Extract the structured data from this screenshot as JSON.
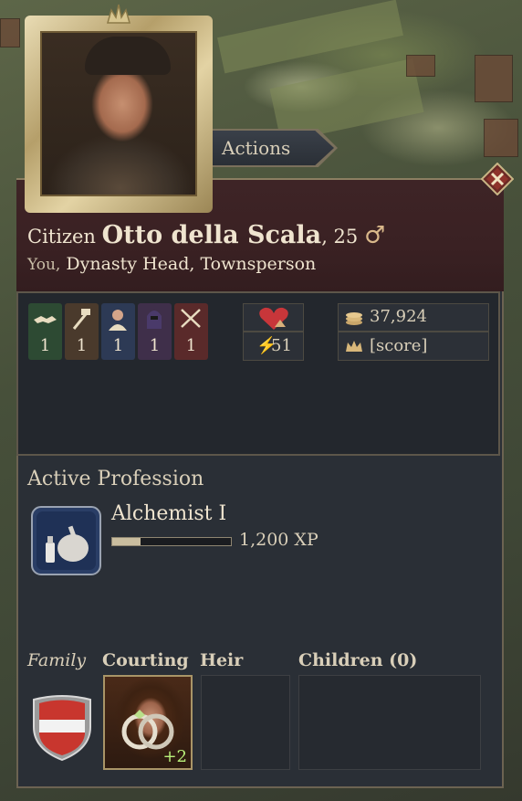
{
  "actions_tab": {
    "label": "Actions"
  },
  "character": {
    "title": "Citizen",
    "name": "Otto della Scala",
    "age_text": ", 25",
    "gender_symbol": "♂",
    "you_label": "You,",
    "role": "Dynasty Head",
    "class_text": ", Townsperson"
  },
  "skills": [
    {
      "icon": "handshake-icon",
      "value": "1",
      "color": "#2d4a33"
    },
    {
      "icon": "hammer-icon",
      "value": "1",
      "color": "#4a3a2c"
    },
    {
      "icon": "scholar-icon",
      "value": "1",
      "color": "#2d3a55"
    },
    {
      "icon": "hooded-figure-icon",
      "value": "1",
      "color": "#3f2f4a"
    },
    {
      "icon": "crossed-swords-icon",
      "value": "1",
      "color": "#5a2a2a"
    }
  ],
  "vitals": {
    "heart_icon": "heart-icon",
    "energy_value": "51"
  },
  "wealth": {
    "money": "37,924",
    "score": "[score]"
  },
  "profession": {
    "section_title": "Active Profession",
    "name": "Alchemist I",
    "xp_text": "1,200 XP",
    "xp_progress": 0.24
  },
  "family": {
    "family_label": "Family",
    "courting_label": "Courting",
    "heir_label": "Heir",
    "children_label": "Children (0)",
    "courting_bonus": "+2"
  },
  "colors": {
    "accent_gold": "#b59f6a",
    "panel_bg": "#2a2f36",
    "header_bg": "#3a2123"
  }
}
